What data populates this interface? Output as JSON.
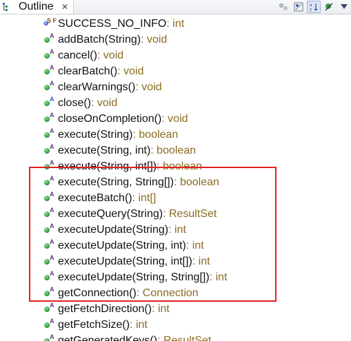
{
  "window": {
    "tab_label": "Outline",
    "tab_close": "✕"
  },
  "toolbar": {
    "buttons": [
      {
        "icon": "gear-cluster-icon"
      },
      {
        "icon": "hide-fields-icon"
      },
      {
        "icon": "sort-az-icon",
        "active": true
      },
      {
        "icon": "hide-non-public-icon"
      },
      {
        "icon": "view-menu-icon"
      }
    ]
  },
  "outline": {
    "items": [
      {
        "name": "SUCCESS_NO_INFO",
        "type": " : int",
        "icon": "static-final-field-icon",
        "overlay": "S F"
      },
      {
        "name": "addBatch(String)",
        "type": " : void",
        "icon": "public-abstract-method-icon",
        "overlay": "A"
      },
      {
        "name": "cancel()",
        "type": " : void",
        "icon": "public-abstract-method-icon",
        "overlay": "A"
      },
      {
        "name": "clearBatch()",
        "type": " : void",
        "icon": "public-abstract-method-icon",
        "overlay": "A"
      },
      {
        "name": "clearWarnings()",
        "type": " : void",
        "icon": "public-abstract-method-icon",
        "overlay": "A"
      },
      {
        "name": "close()",
        "type": " : void",
        "icon": "public-abstract-override-method-icon",
        "overlay": "A"
      },
      {
        "name": "closeOnCompletion()",
        "type": " : void",
        "icon": "public-abstract-method-icon",
        "overlay": "A"
      },
      {
        "name": "execute(String)",
        "type": " : boolean",
        "icon": "public-abstract-method-icon",
        "overlay": "A"
      },
      {
        "name": "execute(String, int)",
        "type": " : boolean",
        "icon": "public-abstract-method-icon",
        "overlay": "A"
      },
      {
        "name": "execute(String, int[])",
        "type": " : boolean",
        "icon": "public-abstract-method-icon",
        "overlay": "A"
      },
      {
        "name": "execute(String, String[])",
        "type": " : boolean",
        "icon": "public-abstract-method-icon",
        "overlay": "A"
      },
      {
        "name": "executeBatch()",
        "type": " : int[]",
        "icon": "public-abstract-method-icon",
        "overlay": "A"
      },
      {
        "name": "executeQuery(String)",
        "type": " : ResultSet",
        "icon": "public-abstract-method-icon",
        "overlay": "A"
      },
      {
        "name": "executeUpdate(String)",
        "type": " : int",
        "icon": "public-abstract-method-icon",
        "overlay": "A"
      },
      {
        "name": "executeUpdate(String, int)",
        "type": " : int",
        "icon": "public-abstract-method-icon",
        "overlay": "A"
      },
      {
        "name": "executeUpdate(String, int[])",
        "type": " : int",
        "icon": "public-abstract-method-icon",
        "overlay": "A"
      },
      {
        "name": "executeUpdate(String, String[])",
        "type": " : int",
        "icon": "public-abstract-method-icon",
        "overlay": "A"
      },
      {
        "name": "getConnection()",
        "type": " : Connection",
        "icon": "public-abstract-method-icon",
        "overlay": "A"
      },
      {
        "name": "getFetchDirection()",
        "type": " : int",
        "icon": "public-abstract-method-icon",
        "overlay": "A"
      },
      {
        "name": "getFetchSize()",
        "type": " : int",
        "icon": "public-abstract-method-icon",
        "overlay": "A"
      },
      {
        "name": "getGeneratedKeys()",
        "type": " : ResultSet",
        "icon": "public-abstract-method-icon",
        "overlay": "A"
      }
    ]
  },
  "colors": {
    "highlight_border": "#e02020",
    "type_text": "#8a6b20",
    "method_icon": "#2f9b3d"
  }
}
